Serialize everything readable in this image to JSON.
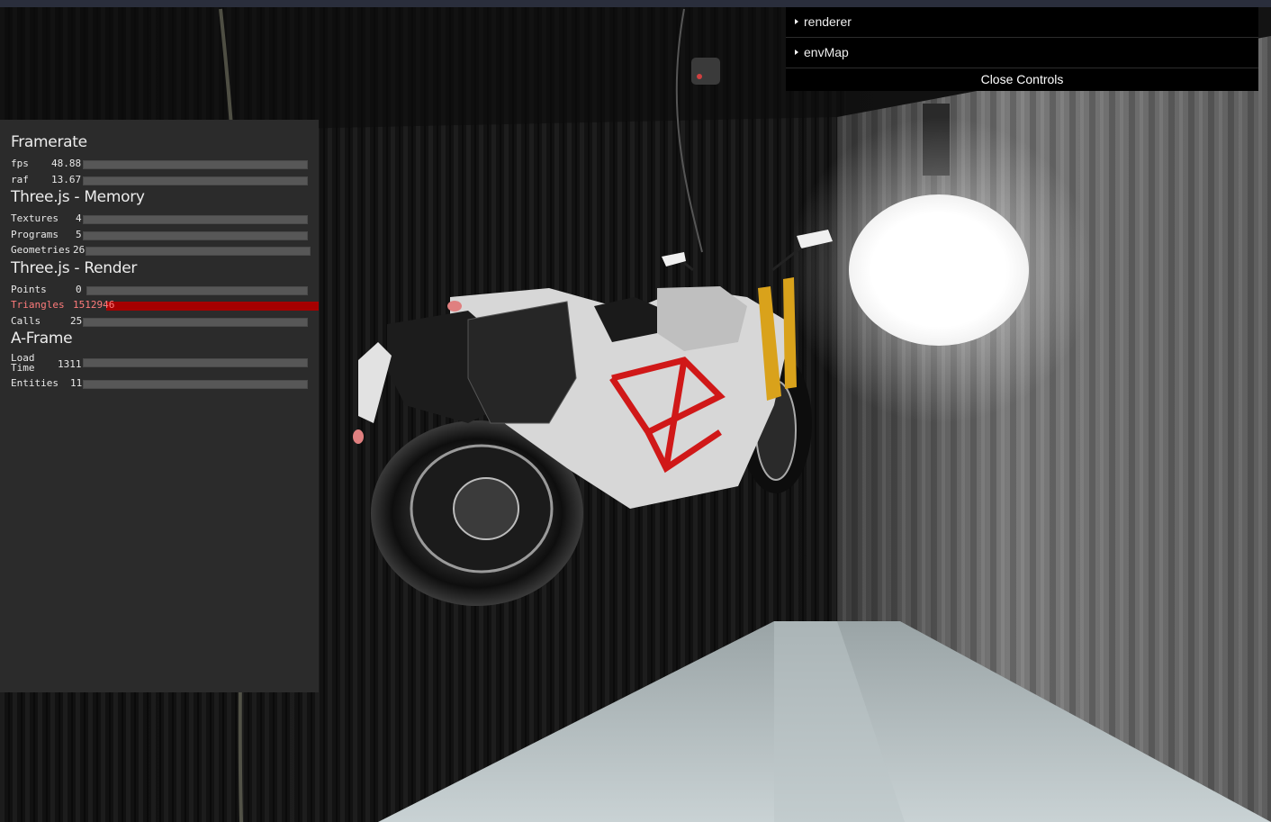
{
  "stats": {
    "groups": [
      {
        "title": "Framerate",
        "rows": [
          {
            "label": "fps",
            "value": "48.88"
          },
          {
            "label": "raf",
            "value": "13.67"
          }
        ]
      },
      {
        "title": "Three.js - Memory",
        "rows": [
          {
            "label": "Textures",
            "value": "4"
          },
          {
            "label": "Programs",
            "value": "5"
          },
          {
            "label": "Geometries",
            "value": "26"
          }
        ]
      },
      {
        "title": "Three.js - Render",
        "rows": [
          {
            "label": "Points",
            "value": "0"
          },
          {
            "label": "Triangles",
            "value": "1512946",
            "alarm": true
          },
          {
            "label": "Calls",
            "value": "25"
          }
        ]
      },
      {
        "title": "A-Frame",
        "rows": [
          {
            "label": "Load\nTime",
            "value": "1311"
          },
          {
            "label": "Entities",
            "value": "11"
          }
        ]
      }
    ]
  },
  "gui": {
    "folders": [
      {
        "label": "renderer"
      },
      {
        "label": "envMap"
      }
    ],
    "close_label": "Close Controls"
  },
  "scene": {
    "colors": {
      "topbar": "#2a2e3c",
      "frame_red": "#d01818",
      "fork_gold": "#d9a21b"
    }
  }
}
